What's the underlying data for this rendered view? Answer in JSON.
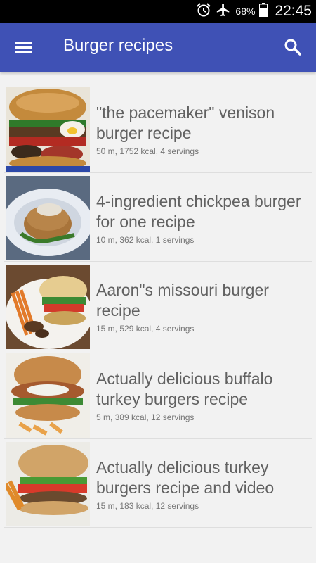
{
  "status_bar": {
    "battery_percent": "68%",
    "time": "22:45",
    "icons": [
      "alarm-icon",
      "airplane-mode-icon",
      "battery-icon"
    ]
  },
  "app_bar": {
    "title": "Burger recipes",
    "menu_icon": "hamburger-menu-icon",
    "search_icon": "search-icon",
    "color": "#3f51b5"
  },
  "recipes": [
    {
      "title": "\"the pacemaker\" venison burger recipe",
      "meta": "50 m, 1752 kcal, 4 servings"
    },
    {
      "title": "4-ingredient chickpea burger for one  recipe",
      "meta": "10 m, 362 kcal, 1 servings"
    },
    {
      "title": "Aaron\"s missouri burger recipe",
      "meta": "15 m, 529 kcal, 4 servings"
    },
    {
      "title": "Actually delicious buffalo turkey burgers recipe",
      "meta": "5 m, 389 kcal, 12 servings"
    },
    {
      "title": "Actually delicious turkey burgers recipe and video",
      "meta": "15 m, 183 kcal, 12 servings"
    }
  ]
}
